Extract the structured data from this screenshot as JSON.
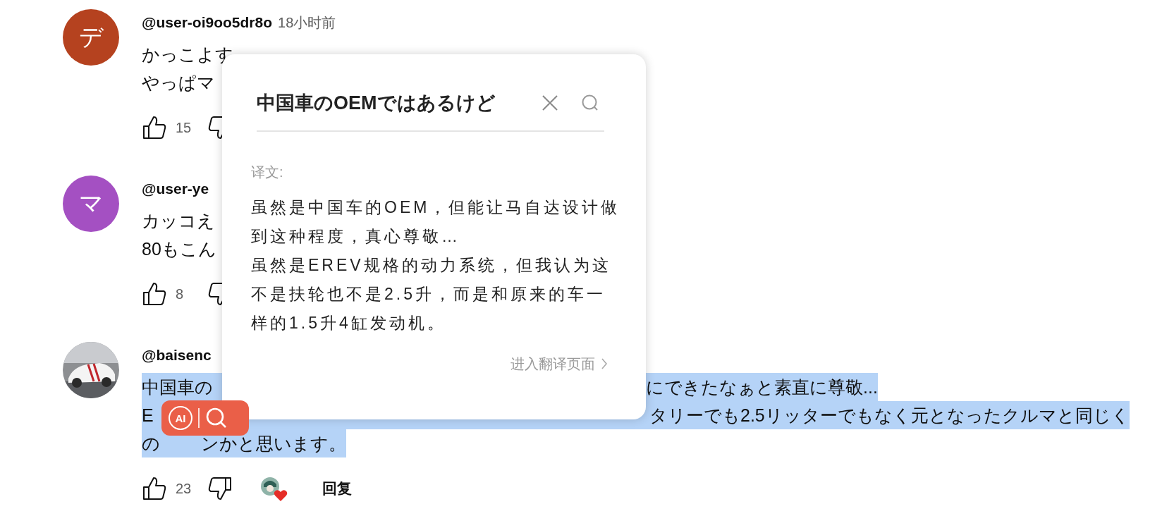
{
  "comments": [
    {
      "avatar": {
        "kind": "letter",
        "letter": "デ",
        "color": "#b5421f"
      },
      "author": "@user-oi9oo5dr8o",
      "time": "18小时前",
      "selected": false,
      "lines": [
        [
          "かっこよす"
        ],
        [
          "やっぱマ"
        ]
      ],
      "likes": "15",
      "creator_hearted": false
    },
    {
      "avatar": {
        "kind": "letter",
        "letter": "マ",
        "color": "#a450c2"
      },
      "author": "@user-ye",
      "selected": false,
      "lines": [
        [
          "カッコえ"
        ],
        [
          "80もこん"
        ]
      ],
      "likes": "8",
      "creator_hearted": false
    },
    {
      "avatar": {
        "kind": "picture"
      },
      "author": "@baisenc",
      "selected": true,
      "lines": [
        [
          "中国車の",
          "にできたなぁと素直に尊敬..."
        ],
        [
          "E",
          "タリーでも2.5リッターでもなく元となったクルマと同じく"
        ],
        [
          "の",
          "ンかと思います。"
        ]
      ],
      "likes": "23",
      "creator_hearted": true,
      "reply": "回复"
    }
  ],
  "translate_popup": {
    "query": "中国車のOEMではあるけど",
    "label": "译文:",
    "translation": [
      "虽然是中国车的OEM，但能让马自达设计做到这种程度，真心尊敬…",
      "虽然是EREV规格的动力系统，但我认为这不是扶轮也不是2.5升，而是和原来的车一样的1.5升4缸发动机。"
    ],
    "link": "进入翻译页面"
  },
  "selection_toolbar": {
    "ai_label": "AI"
  }
}
